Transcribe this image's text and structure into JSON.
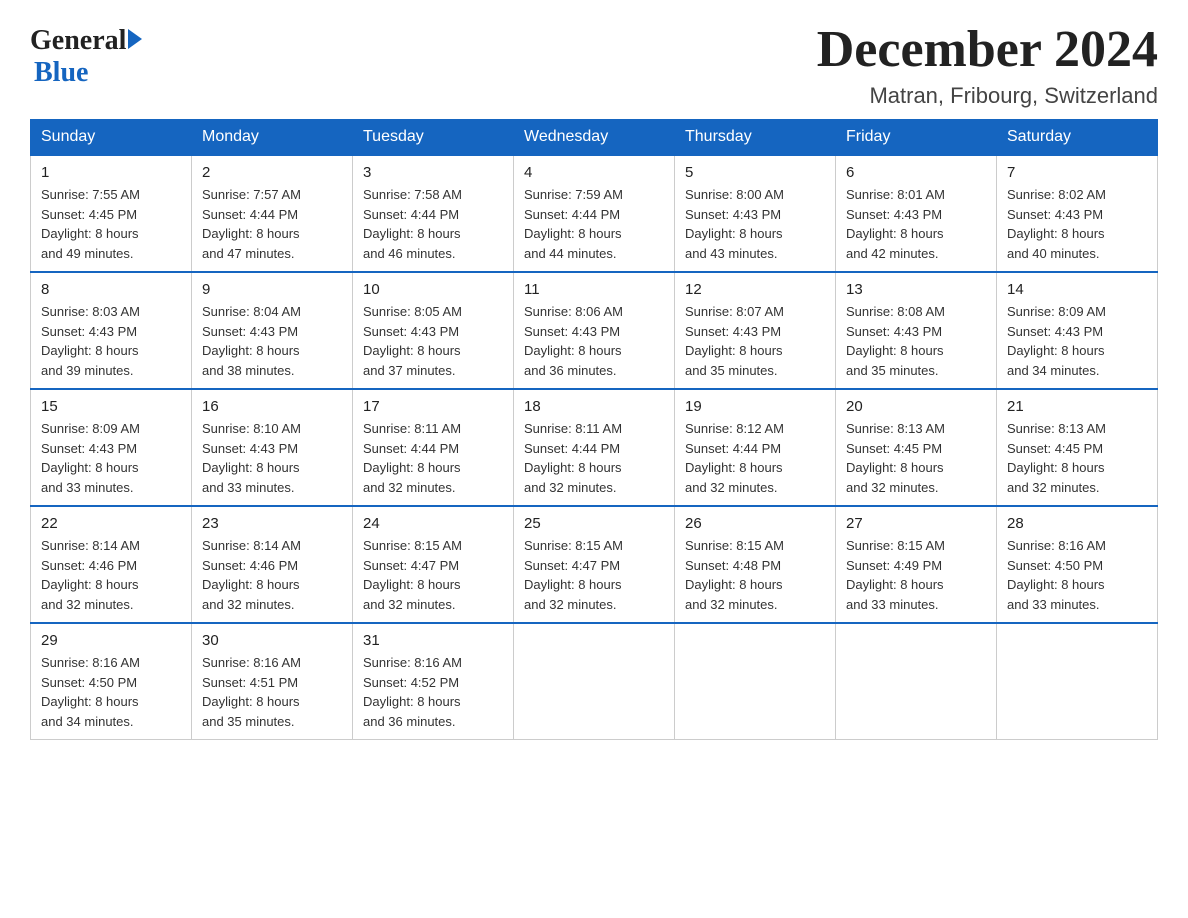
{
  "header": {
    "logo_general": "General",
    "logo_blue": "Blue",
    "month_title": "December 2024",
    "location": "Matran, Fribourg, Switzerland"
  },
  "days_of_week": [
    "Sunday",
    "Monday",
    "Tuesday",
    "Wednesday",
    "Thursday",
    "Friday",
    "Saturday"
  ],
  "weeks": [
    [
      {
        "day": "1",
        "sunrise": "7:55 AM",
        "sunset": "4:45 PM",
        "daylight": "8 hours and 49 minutes."
      },
      {
        "day": "2",
        "sunrise": "7:57 AM",
        "sunset": "4:44 PM",
        "daylight": "8 hours and 47 minutes."
      },
      {
        "day": "3",
        "sunrise": "7:58 AM",
        "sunset": "4:44 PM",
        "daylight": "8 hours and 46 minutes."
      },
      {
        "day": "4",
        "sunrise": "7:59 AM",
        "sunset": "4:44 PM",
        "daylight": "8 hours and 44 minutes."
      },
      {
        "day": "5",
        "sunrise": "8:00 AM",
        "sunset": "4:43 PM",
        "daylight": "8 hours and 43 minutes."
      },
      {
        "day": "6",
        "sunrise": "8:01 AM",
        "sunset": "4:43 PM",
        "daylight": "8 hours and 42 minutes."
      },
      {
        "day": "7",
        "sunrise": "8:02 AM",
        "sunset": "4:43 PM",
        "daylight": "8 hours and 40 minutes."
      }
    ],
    [
      {
        "day": "8",
        "sunrise": "8:03 AM",
        "sunset": "4:43 PM",
        "daylight": "8 hours and 39 minutes."
      },
      {
        "day": "9",
        "sunrise": "8:04 AM",
        "sunset": "4:43 PM",
        "daylight": "8 hours and 38 minutes."
      },
      {
        "day": "10",
        "sunrise": "8:05 AM",
        "sunset": "4:43 PM",
        "daylight": "8 hours and 37 minutes."
      },
      {
        "day": "11",
        "sunrise": "8:06 AM",
        "sunset": "4:43 PM",
        "daylight": "8 hours and 36 minutes."
      },
      {
        "day": "12",
        "sunrise": "8:07 AM",
        "sunset": "4:43 PM",
        "daylight": "8 hours and 35 minutes."
      },
      {
        "day": "13",
        "sunrise": "8:08 AM",
        "sunset": "4:43 PM",
        "daylight": "8 hours and 35 minutes."
      },
      {
        "day": "14",
        "sunrise": "8:09 AM",
        "sunset": "4:43 PM",
        "daylight": "8 hours and 34 minutes."
      }
    ],
    [
      {
        "day": "15",
        "sunrise": "8:09 AM",
        "sunset": "4:43 PM",
        "daylight": "8 hours and 33 minutes."
      },
      {
        "day": "16",
        "sunrise": "8:10 AM",
        "sunset": "4:43 PM",
        "daylight": "8 hours and 33 minutes."
      },
      {
        "day": "17",
        "sunrise": "8:11 AM",
        "sunset": "4:44 PM",
        "daylight": "8 hours and 32 minutes."
      },
      {
        "day": "18",
        "sunrise": "8:11 AM",
        "sunset": "4:44 PM",
        "daylight": "8 hours and 32 minutes."
      },
      {
        "day": "19",
        "sunrise": "8:12 AM",
        "sunset": "4:44 PM",
        "daylight": "8 hours and 32 minutes."
      },
      {
        "day": "20",
        "sunrise": "8:13 AM",
        "sunset": "4:45 PM",
        "daylight": "8 hours and 32 minutes."
      },
      {
        "day": "21",
        "sunrise": "8:13 AM",
        "sunset": "4:45 PM",
        "daylight": "8 hours and 32 minutes."
      }
    ],
    [
      {
        "day": "22",
        "sunrise": "8:14 AM",
        "sunset": "4:46 PM",
        "daylight": "8 hours and 32 minutes."
      },
      {
        "day": "23",
        "sunrise": "8:14 AM",
        "sunset": "4:46 PM",
        "daylight": "8 hours and 32 minutes."
      },
      {
        "day": "24",
        "sunrise": "8:15 AM",
        "sunset": "4:47 PM",
        "daylight": "8 hours and 32 minutes."
      },
      {
        "day": "25",
        "sunrise": "8:15 AM",
        "sunset": "4:47 PM",
        "daylight": "8 hours and 32 minutes."
      },
      {
        "day": "26",
        "sunrise": "8:15 AM",
        "sunset": "4:48 PM",
        "daylight": "8 hours and 32 minutes."
      },
      {
        "day": "27",
        "sunrise": "8:15 AM",
        "sunset": "4:49 PM",
        "daylight": "8 hours and 33 minutes."
      },
      {
        "day": "28",
        "sunrise": "8:16 AM",
        "sunset": "4:50 PM",
        "daylight": "8 hours and 33 minutes."
      }
    ],
    [
      {
        "day": "29",
        "sunrise": "8:16 AM",
        "sunset": "4:50 PM",
        "daylight": "8 hours and 34 minutes."
      },
      {
        "day": "30",
        "sunrise": "8:16 AM",
        "sunset": "4:51 PM",
        "daylight": "8 hours and 35 minutes."
      },
      {
        "day": "31",
        "sunrise": "8:16 AM",
        "sunset": "4:52 PM",
        "daylight": "8 hours and 36 minutes."
      },
      null,
      null,
      null,
      null
    ]
  ],
  "labels": {
    "sunrise": "Sunrise:",
    "sunset": "Sunset:",
    "daylight": "Daylight:"
  }
}
